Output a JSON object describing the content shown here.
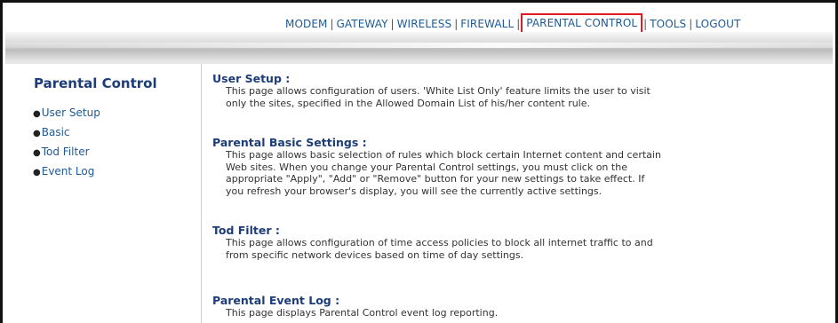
{
  "topnav": {
    "items": [
      "MODEM",
      "GATEWAY",
      "WIRELESS",
      "FIREWALL",
      "PARENTAL CONTROL",
      "TOOLS",
      "LOGOUT"
    ],
    "separator": "|"
  },
  "sidebar": {
    "title": "Parental Control",
    "items": [
      "User Setup",
      "Basic",
      "Tod Filter",
      "Event Log"
    ]
  },
  "sections": [
    {
      "title": "User Setup :",
      "lines": [
        "This page allows configuration of users. 'White List Only' feature limits the user to visit",
        "only the sites, specified in the Allowed Domain List of his/her content rule."
      ]
    },
    {
      "title": "Parental Basic Settings :",
      "lines": [
        "This page allows basic selection of rules which block certain Internet content and certain",
        "Web sites. When you change your Parental Control settings, you must click on the",
        "appropriate \"Apply\", \"Add\" or \"Remove\" button for your new settings to take effect. If",
        "you refresh your browser's display, you will see the currently active settings."
      ]
    },
    {
      "title": "Tod Filter :",
      "lines": [
        "This page allows configuration of time access policies to block all internet traffic to and",
        "from specific network devices based on time of day settings."
      ]
    },
    {
      "title": "Parental Event Log :",
      "lines": [
        "This page displays Parental Control event log reporting."
      ]
    }
  ],
  "colors": {
    "link": "#1f5a94",
    "heading": "#1c3d78",
    "highlight_box": "#e01b24"
  }
}
